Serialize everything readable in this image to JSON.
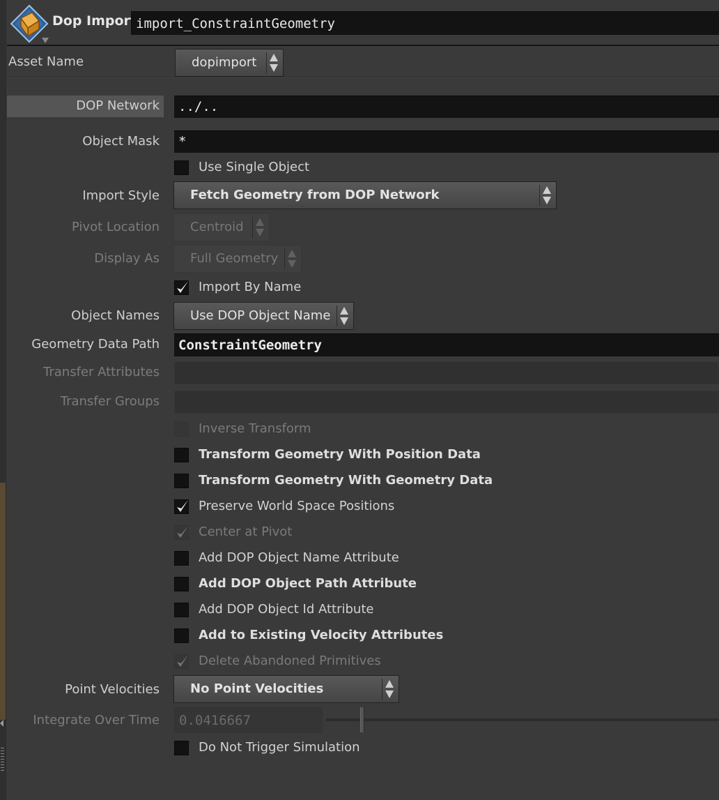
{
  "header": {
    "node_type": "Dop Import",
    "node_name": "import_ConstraintGeometry",
    "icon": "dop-import-node-icon"
  },
  "asset": {
    "label": "Asset Name",
    "value": "dopimport"
  },
  "params": {
    "dop_network": {
      "label": "DOP Network",
      "value": "../.."
    },
    "object_mask": {
      "label": "Object Mask",
      "value": "*"
    },
    "use_single_object": {
      "label": "Use Single Object",
      "checked": false
    },
    "import_style": {
      "label": "Import Style",
      "value": "Fetch Geometry from DOP Network"
    },
    "pivot_location": {
      "label": "Pivot Location",
      "value": "Centroid"
    },
    "display_as": {
      "label": "Display As",
      "value": "Full Geometry"
    },
    "import_by_name": {
      "label": "Import By Name",
      "checked": true
    },
    "object_names": {
      "label": "Object Names",
      "value": "Use DOP Object Name"
    },
    "geometry_data_path": {
      "label": "Geometry Data Path",
      "value": "ConstraintGeometry"
    },
    "transfer_attributes": {
      "label": "Transfer Attributes",
      "value": ""
    },
    "transfer_groups": {
      "label": "Transfer Groups",
      "value": ""
    },
    "inverse_transform": {
      "label": "Inverse Transform",
      "checked": false
    },
    "transform_position": {
      "label": "Transform Geometry With Position Data",
      "checked": false
    },
    "transform_geometry": {
      "label": "Transform Geometry With Geometry Data",
      "checked": false
    },
    "preserve_world": {
      "label": "Preserve World Space Positions",
      "checked": true
    },
    "center_pivot": {
      "label": "Center at Pivot",
      "checked": true
    },
    "add_name_attr": {
      "label": "Add DOP Object Name Attribute",
      "checked": false
    },
    "add_path_attr": {
      "label": "Add DOP Object Path Attribute",
      "checked": false
    },
    "add_id_attr": {
      "label": "Add DOP Object Id Attribute",
      "checked": false
    },
    "add_velocity": {
      "label": "Add to Existing Velocity Attributes",
      "checked": false
    },
    "delete_abandoned": {
      "label": "Delete Abandoned Primitives",
      "checked": true
    },
    "point_velocities": {
      "label": "Point Velocities",
      "value": "No Point Velocities"
    },
    "integrate_time": {
      "label": "Integrate Over Time",
      "value": "0.0416667"
    },
    "no_trigger": {
      "label": "Do Not Trigger Simulation",
      "checked": false
    }
  },
  "colors": {
    "background": "#3a3a3a",
    "field": "#131313",
    "text": "#cccccc",
    "icon_orange": "#e8a23a",
    "icon_blue": "#3a6ea8"
  }
}
